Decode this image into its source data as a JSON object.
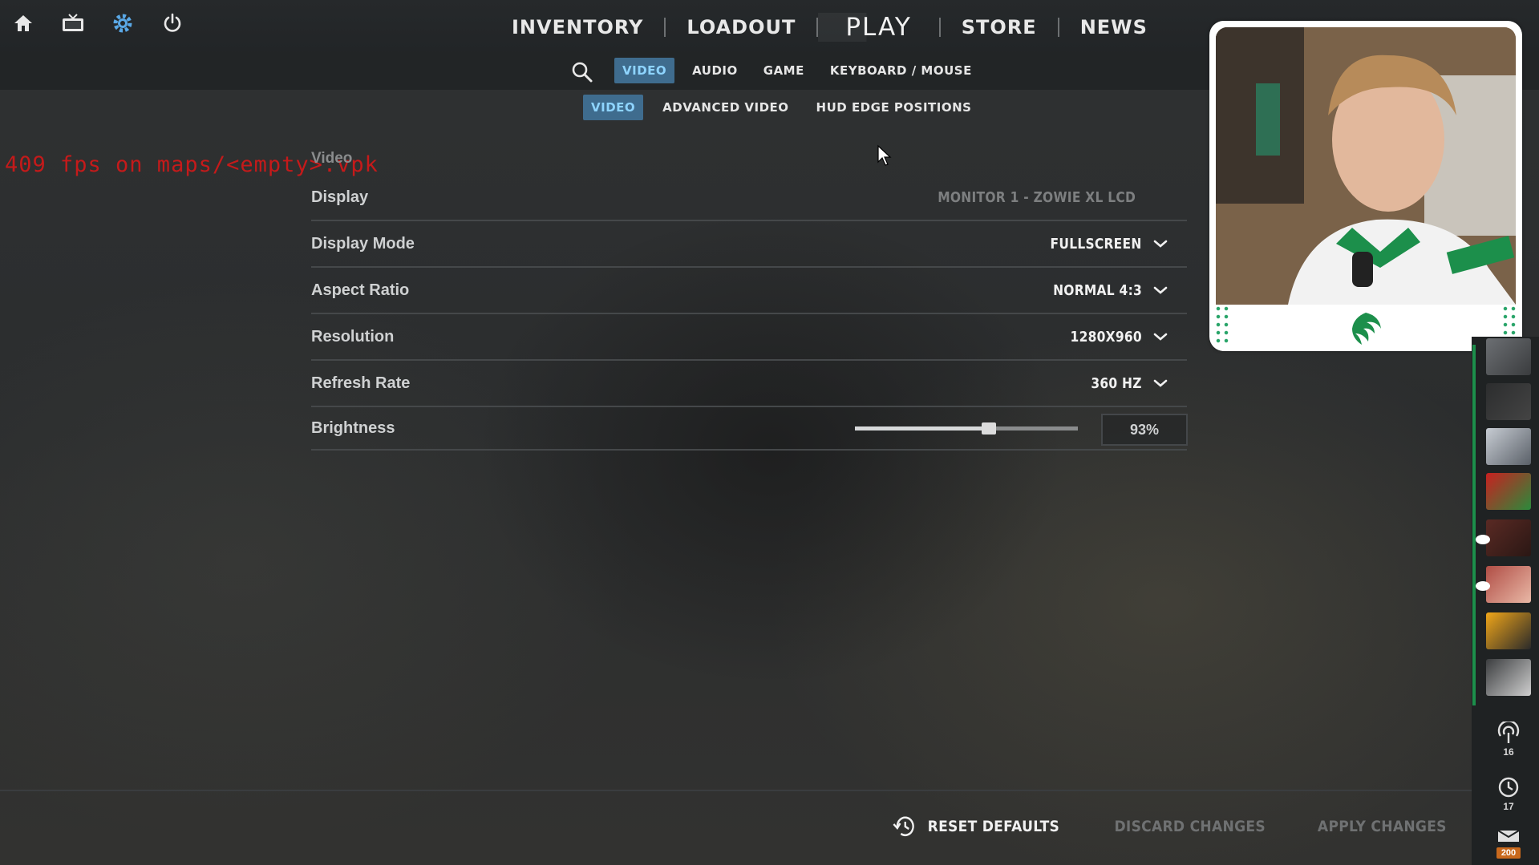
{
  "top_nav": {
    "icons": [
      "home-icon",
      "tv-icon",
      "gear-icon",
      "power-icon"
    ],
    "items": [
      "INVENTORY",
      "LOADOUT",
      "PLAY",
      "STORE",
      "NEWS"
    ]
  },
  "settings_tabs": [
    "VIDEO",
    "AUDIO",
    "GAME",
    "KEYBOARD / MOUSE"
  ],
  "video_subtabs": [
    "VIDEO",
    "ADVANCED VIDEO",
    "HUD EDGE POSITIONS"
  ],
  "debug_overlay": "409 fps on maps/<empty>.vpk",
  "video": {
    "section_title": "Video",
    "rows": [
      {
        "label": "Display",
        "value": "MONITOR 1 - ZOWIE XL LCD"
      },
      {
        "label": "Display Mode",
        "value": "FULLSCREEN"
      },
      {
        "label": "Aspect Ratio",
        "value": "NORMAL 4:3"
      },
      {
        "label": "Resolution",
        "value": "1280X960"
      },
      {
        "label": "Refresh Rate",
        "value": "360 HZ"
      }
    ],
    "brightness": {
      "label": "Brightness",
      "value_text": "93%",
      "fraction": 0.6
    }
  },
  "bottom_actions": {
    "reset": "RESET DEFAULTS",
    "discard": "DISCARD CHANGES",
    "apply": "APPLY CHANGES"
  },
  "sidebar": {
    "stat_1": "16",
    "stat_2": "17",
    "mail": "200"
  },
  "colors": {
    "accent_tab": "#3f6c8e",
    "debug_red": "#c51a1a",
    "friend_green": "#1c8f4b",
    "mail_badge": "#c9691d"
  }
}
